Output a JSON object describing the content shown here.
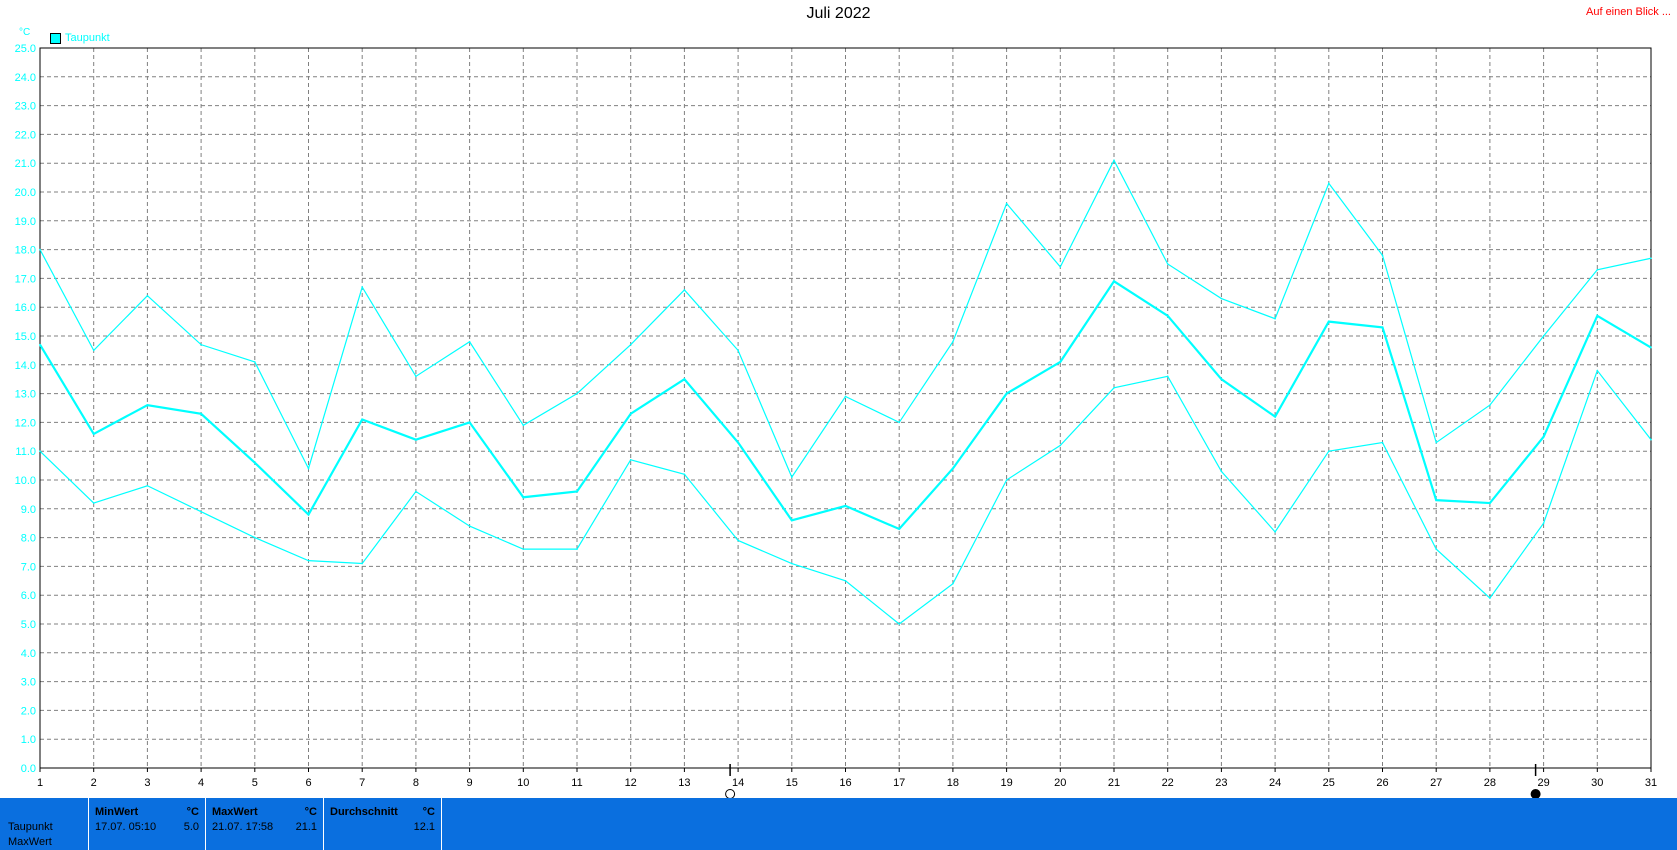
{
  "header": {
    "title": "Juli 2022",
    "overview_link": "Auf einen Blick ..."
  },
  "legend": {
    "label": "Taupunkt",
    "color": "#00ffff"
  },
  "chart_data": {
    "type": "line",
    "title": "Juli 2022",
    "ylabel": "°C",
    "xlabel": "",
    "ylim": [
      0,
      25
    ],
    "xlim": [
      1,
      31
    ],
    "grid": true,
    "legend_position": "top-left",
    "x": [
      1,
      2,
      3,
      4,
      5,
      6,
      7,
      8,
      9,
      10,
      11,
      12,
      13,
      14,
      15,
      16,
      17,
      18,
      19,
      20,
      21,
      22,
      23,
      24,
      25,
      26,
      27,
      28,
      29,
      30,
      31
    ],
    "y_ticks": [
      "0.0",
      "1.0",
      "2.0",
      "3.0",
      "4.0",
      "5.0",
      "6.0",
      "7.0",
      "8.0",
      "9.0",
      "10.0",
      "11.0",
      "12.0",
      "13.0",
      "14.0",
      "15.0",
      "16.0",
      "17.0",
      "18.0",
      "19.0",
      "20.0",
      "21.0",
      "22.0",
      "23.0",
      "24.0",
      "25.0"
    ],
    "x_ticks": [
      "1",
      "2",
      "3",
      "4",
      "5",
      "6",
      "7",
      "8",
      "9",
      "10",
      "11",
      "12",
      "13",
      "14",
      "15",
      "16",
      "17",
      "18",
      "19",
      "20",
      "21",
      "22",
      "23",
      "24",
      "25",
      "26",
      "27",
      "28",
      "29",
      "30",
      "31"
    ],
    "series": [
      {
        "name": "Taupunkt",
        "color": "#00ffff",
        "role": "max",
        "values": [
          18.0,
          14.5,
          16.4,
          14.7,
          14.1,
          10.4,
          16.7,
          13.6,
          14.8,
          11.9,
          13.0,
          14.7,
          16.6,
          14.5,
          10.1,
          12.9,
          12.0,
          14.8,
          19.6,
          17.4,
          21.1,
          17.5,
          16.3,
          15.6,
          20.3,
          17.8,
          11.3,
          12.6,
          15.0,
          17.3,
          17.7
        ]
      },
      {
        "name": "Taupunkt",
        "color": "#00ffff",
        "role": "mean",
        "values": [
          14.7,
          11.6,
          12.6,
          12.3,
          10.6,
          8.8,
          12.1,
          11.4,
          12.0,
          9.4,
          9.6,
          12.3,
          13.5,
          11.3,
          8.6,
          9.1,
          8.3,
          10.4,
          13.0,
          14.1,
          16.9,
          15.7,
          13.5,
          12.2,
          15.5,
          15.3,
          9.3,
          9.2,
          11.5,
          15.7,
          14.6
        ]
      },
      {
        "name": "Taupunkt",
        "color": "#00ffff",
        "role": "min",
        "values": [
          11.0,
          9.2,
          9.8,
          8.9,
          8.0,
          7.2,
          7.1,
          9.6,
          8.4,
          7.6,
          7.6,
          10.7,
          10.2,
          7.9,
          7.1,
          6.5,
          5.0,
          6.4,
          10.0,
          11.2,
          13.2,
          13.6,
          10.3,
          8.2,
          11.0,
          11.3,
          7.6,
          5.9,
          8.5,
          13.8,
          11.4
        ]
      }
    ],
    "markers": [
      {
        "x": 14,
        "symbol": "full-moon"
      },
      {
        "x": 29,
        "symbol": "new-moon"
      }
    ]
  },
  "stats": {
    "row_labels": [
      "Taupunkt",
      "MaxWert"
    ],
    "min": {
      "header": "MinWert",
      "unit": "°C",
      "time": "17.07.  05:10",
      "value": "5.0"
    },
    "max": {
      "header": "MaxWert",
      "unit": "°C",
      "time": "21.07.  17:58",
      "value": "21.1"
    },
    "avg": {
      "header": "Durchschnitt",
      "unit": "°C",
      "value": "12.1"
    }
  }
}
